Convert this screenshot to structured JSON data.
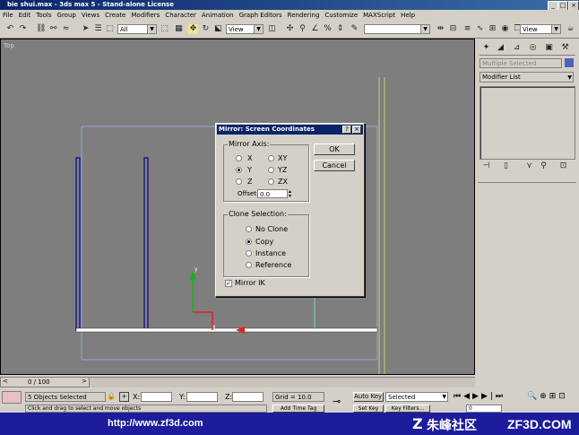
{
  "window": {
    "title": "bie shui.max - 3ds max 5 - Stand-alone License"
  },
  "menu": [
    "File",
    "Edit",
    "Tools",
    "Group",
    "Views",
    "Create",
    "Modifiers",
    "Character",
    "Animation",
    "Graph Editors",
    "Rendering",
    "Customize",
    "MAXScript",
    "Help"
  ],
  "toolbar": {
    "selection_filter": "All",
    "ref_coord": "View",
    "named_sel": "",
    "view_combo": "View"
  },
  "viewport": {
    "label": "Top"
  },
  "cmd_panel": {
    "selection_label": "Multiple Selected",
    "modifier_list": "Modifier List"
  },
  "dialog": {
    "title": "Mirror: Screen Coordinates",
    "help_btn": "?",
    "close_btn": "×",
    "mirror_axis_label": "Mirror Axis:",
    "axes": [
      "X",
      "Y",
      "Z",
      "XY",
      "YZ",
      "ZX"
    ],
    "selected_axis": "Y",
    "offset_label": "Offset:",
    "offset_value": "0.0",
    "ok": "OK",
    "cancel": "Cancel",
    "clone_label": "Clone Selection:",
    "clone_options": [
      "No Clone",
      "Copy",
      "Instance",
      "Reference"
    ],
    "selected_clone": "Copy",
    "mirror_ik_label": "Mirror IK",
    "mirror_ik_checked": true
  },
  "timeline": {
    "frame": "0 / 100"
  },
  "status": {
    "selected": "5 Objects Selected",
    "x_label": "X:",
    "y_label": "Y:",
    "z_label": "Z:",
    "grid": "Grid = 10.0",
    "prompt": "Click and drag to select and move objects",
    "auto_key": "Auto Key",
    "set_key": "Set Key",
    "key_mode": "Selected",
    "key_filters": "Key Filters...",
    "add_time_tag": "Add Time Tag",
    "frame_field": "0"
  },
  "banner": {
    "url": "http://www.zf3d.com",
    "brand": "朱峰社区",
    "site": "ZF3D.COM"
  }
}
